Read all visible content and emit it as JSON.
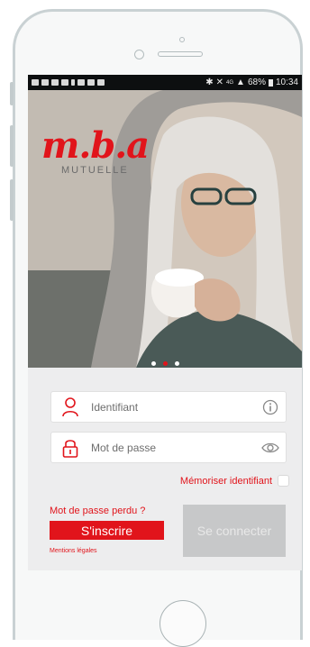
{
  "status_bar": {
    "battery": "68%",
    "time": "10:34",
    "network": "4G"
  },
  "brand": {
    "logo_text": "m.b.a",
    "logo_subtext": "MUTUELLE",
    "accent_color": "#e1141b"
  },
  "carousel": {
    "slide_count": 3,
    "active_index": 1
  },
  "login_form": {
    "identifier_placeholder": "Identifiant",
    "password_placeholder": "Mot de passe",
    "remember_label": "Mémoriser identifiant",
    "remember_checked": false,
    "forgot_password_label": "Mot de passe perdu ?",
    "signup_label": "S'inscrire",
    "legal_label": "Mentions légales",
    "connect_label": "Se connecter"
  },
  "icons": {
    "identifier": "person-icon",
    "identifier_trail": "info-icon",
    "password": "lock-icon",
    "password_trail": "eye-icon"
  }
}
